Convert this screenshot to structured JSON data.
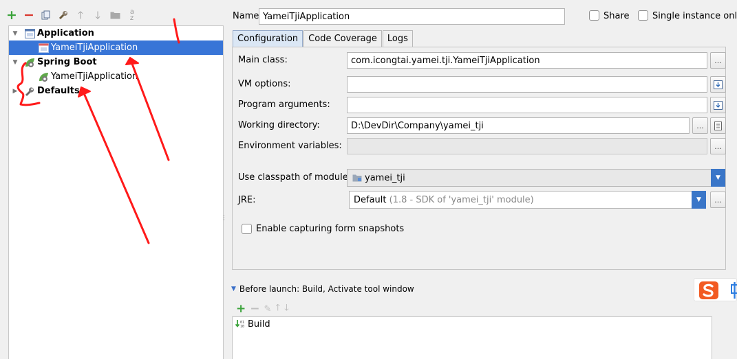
{
  "left_toolbar": {
    "icons": [
      "add-icon",
      "remove-icon",
      "copy-icon",
      "edit-defaults-icon",
      "move-up-icon",
      "move-down-icon",
      "folder-icon",
      "sort-az-icon"
    ]
  },
  "tree": {
    "items": [
      {
        "label": "Application",
        "icon": "application-icon"
      },
      {
        "label": "YameiTjiApplication",
        "icon": "app-config-icon"
      },
      {
        "label": "Spring Boot",
        "icon": "spring-boot-icon"
      },
      {
        "label": "YameiTjiApplication",
        "icon": "spring-config-icon"
      },
      {
        "label": "Defaults",
        "icon": "wrench-icon"
      }
    ]
  },
  "header": {
    "name_label": "Name:",
    "name_value": "YameiTjiApplication",
    "share_label": "Share",
    "single_instance_label": "Single instance only"
  },
  "tabs": [
    "Configuration",
    "Code Coverage",
    "Logs"
  ],
  "config": {
    "main_class_label": "Main class:",
    "main_class_value": "com.icongtai.yamei.tji.YameiTjiApplication",
    "vm_options_label": "VM options:",
    "vm_options_value": "",
    "program_args_label": "Program arguments:",
    "program_args_value": "",
    "working_dir_label": "Working directory:",
    "working_dir_value": "D:\\DevDir\\Company\\yamei_tji",
    "env_vars_label": "Environment variables:",
    "env_vars_value": "",
    "classpath_label": "Use classpath of module:",
    "classpath_value": "yamei_tji",
    "jre_label": "JRE:",
    "jre_value": "Default",
    "jre_detail": " (1.8 - SDK of 'yamei_tji' module)",
    "snapshots_label": "Enable capturing form snapshots",
    "dots": "..."
  },
  "before_launch": {
    "title": "Before launch: Build, Activate tool window",
    "items": [
      "Build"
    ]
  },
  "colors": {
    "selection": "#3875d7",
    "annotation_red": "#ff1a1a",
    "combo_arrow": "#3a76c8"
  }
}
